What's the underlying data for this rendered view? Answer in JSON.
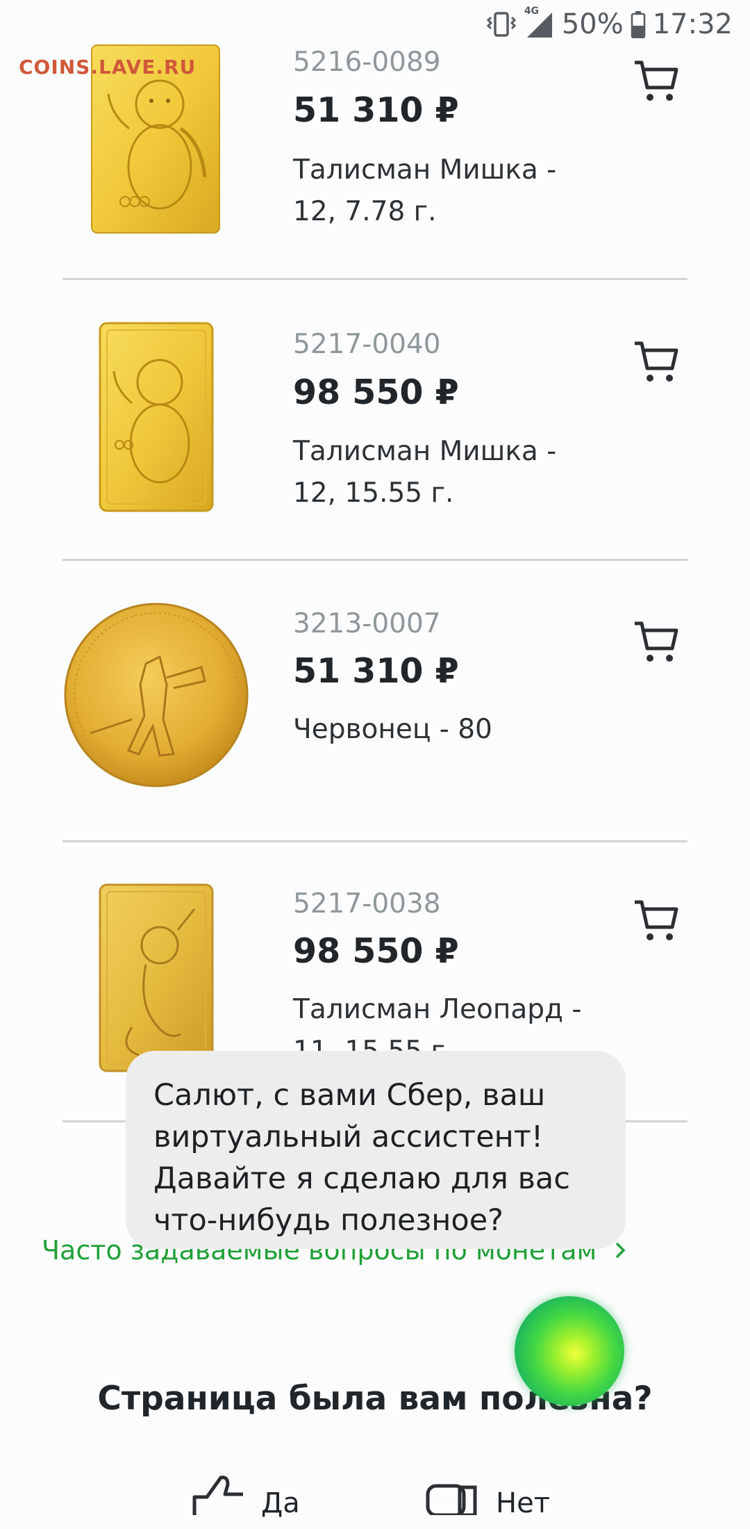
{
  "status_bar": {
    "network": "4G",
    "battery": "50%",
    "time": "17:32"
  },
  "watermark": "COINS.LAVE.RU",
  "products": [
    {
      "code": "5216-0089",
      "price": "51 310 ₽",
      "name": "Талисман Мишка - 12, 7.78 г.",
      "image": "gold-bar-bear"
    },
    {
      "code": "5217-0040",
      "price": "98 550 ₽",
      "name": "Талисман Мишка - 12, 15.55 г.",
      "image": "gold-bar-bear"
    },
    {
      "code": "3213-0007",
      "price": "51 310 ₽",
      "name": "Червонец - 80",
      "image": "gold-coin-chervonets"
    },
    {
      "code": "5217-0038",
      "price": "98 550 ₽",
      "name": "Талисман Леопард - 11, 15.55 г.",
      "image": "gold-bar-leopard"
    }
  ],
  "faq_link": "Часто задаваемые вопросы по монетам",
  "assistant": {
    "message": "Салют, с вами Сбер, ваш виртуальный ассистент! Давайте я сделаю для вас что-нибудь полезное?"
  },
  "feedback": {
    "title": "Страница была вам полезна?",
    "yes_label": "Да",
    "no_label": "Нет"
  },
  "colors": {
    "accent_green": "#21A038",
    "text": "#21262A",
    "muted": "#8F979C",
    "watermark": "#D0583A"
  }
}
